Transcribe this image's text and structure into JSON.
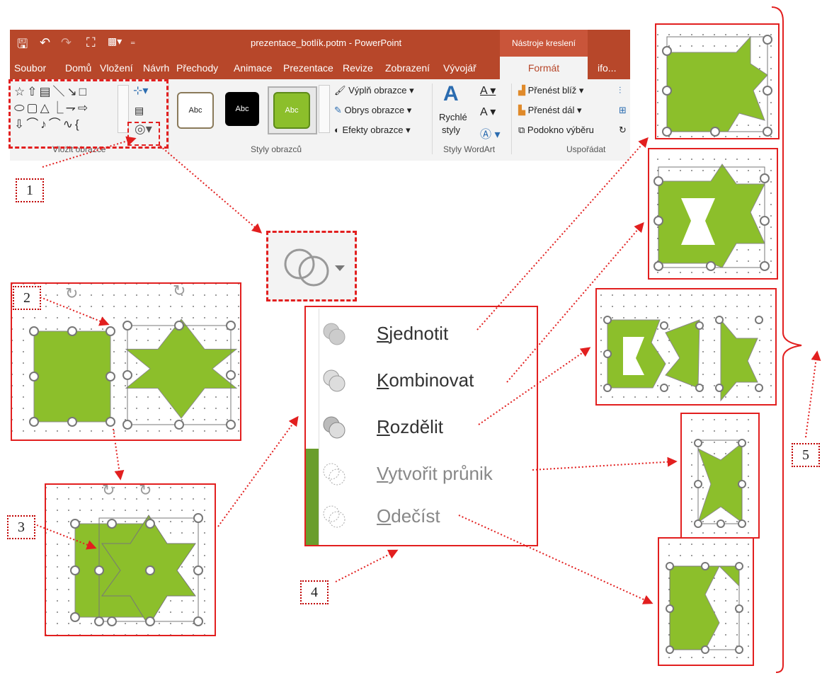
{
  "titlebar": {
    "document_title": "prezentace_botlík.potm - PowerPoint",
    "context_label": "Nástroje kreslení"
  },
  "tabs": [
    "Soubor",
    "Domů",
    "Vložení",
    "Návrh",
    "Přechody",
    "Animace",
    "Prezentace",
    "Revize",
    "Zobrazení",
    "Vývojář",
    "Formát",
    "ifo..."
  ],
  "ribbon": {
    "groups": {
      "insert_shapes": "Vložit obrazce",
      "shape_styles": "Styly obrazců",
      "wordart_styles": "Styly WordArt",
      "arrange": "Uspořádat"
    },
    "style_samples": [
      "Abc",
      "Abc",
      "Abc"
    ],
    "shape_style_cmds": [
      "Výplň obrazce",
      "Obrys obrazce",
      "Efekty obrazce"
    ],
    "quick_styles": [
      "Rychlé",
      "styly"
    ],
    "arrange_cmds": [
      "Přenést blíž",
      "Přenést dál",
      "Podokno výběru"
    ]
  },
  "merge_menu": {
    "items": [
      {
        "label": "Sjednotit",
        "key": "S",
        "rest": "jednotit",
        "enabled": true
      },
      {
        "label": "Kombinovat",
        "key": "K",
        "rest": "ombinovat",
        "enabled": true
      },
      {
        "label": "Rozdělit",
        "key": "R",
        "rest": "ozdělit",
        "enabled": true
      },
      {
        "label": "Vytvořit průnik",
        "key": "V",
        "rest": "ytvořit průnik",
        "enabled": false
      },
      {
        "label": "Odečíst",
        "key": "O",
        "rest": "dečíst",
        "enabled": false
      }
    ]
  },
  "callouts": [
    "1",
    "2",
    "3",
    "4",
    "5"
  ],
  "colors": {
    "accent": "#b7472a",
    "shape_fill": "#8cbf2b",
    "annotation": "#e21f1f"
  },
  "icons": [
    "save-icon",
    "undo-icon",
    "redo-icon",
    "present-icon",
    "merge-shapes-icon",
    "rotate-handle-icon"
  ]
}
